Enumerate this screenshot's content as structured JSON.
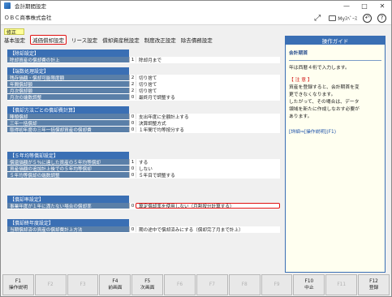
{
  "window": {
    "title": "会計期間設定"
  },
  "toolbar": {
    "company": "ＯＢＣ商事株式会社",
    "my_label": "Myｽﾍﾟｰｽ"
  },
  "mode_badge": "修正",
  "tabs": [
    {
      "label": "基本設定"
    },
    {
      "label": "減価償却設定"
    },
    {
      "label": "リース設定"
    },
    {
      "label": "償却資産税設定"
    },
    {
      "label": "制度改正設定"
    },
    {
      "label": "除去債務設定"
    }
  ],
  "sections": [
    {
      "title": "【除却設定】",
      "rows": [
        {
          "label": "除却資産の償却費の計上",
          "num": "1",
          "value": "除却月まで"
        }
      ]
    },
    {
      "title": "【端数処理設定】",
      "rows": [
        {
          "label": "残存価額・償却可能限度額",
          "num": "2",
          "value": "切り捨て"
        },
        {
          "label": "年間償却額",
          "num": "2",
          "value": "切り捨て"
        },
        {
          "label": "月次償却額",
          "num": "2",
          "value": "切り捨て"
        },
        {
          "label": "月次の端数調整",
          "num": "0",
          "value": "最終月で調整する"
        }
      ]
    },
    {
      "title": "【償却方法ごとの償却費計算】",
      "rows": [
        {
          "label": "陣頭償却",
          "num": "0",
          "value": "支出年度に全額計上する"
        },
        {
          "label": "三年一括償却",
          "num": "0",
          "value": "決算調整方式"
        },
        {
          "label": "取得初年度の三年一括償却資産の償却費",
          "num": "0",
          "value": "１年間で均等按分する"
        }
      ]
    },
    {
      "title": "【５年均等償却設定】",
      "rows": [
        {
          "label": "償還価額が５％に達した資産の５年均等償却",
          "num": "1",
          "value": "する"
        },
        {
          "label": "資産価額の追加計上後での５年均等償却",
          "num": "0",
          "value": "しない"
        },
        {
          "label": "５年均等償却の端数調整",
          "num": "0",
          "value": "５年目で調整する"
        }
      ]
    },
    {
      "title": "【償却率設定】",
      "rows": [
        {
          "label": "事業年度が１年に満たない場合の償却率",
          "num": "0",
          "value": "算定償却率を使用しない（月割按分計算する）",
          "highlight": true
        }
      ]
    },
    {
      "title": "【償却終年度設定】",
      "rows": [
        {
          "label": "当期償却済の資産の償却費計上方法",
          "num": "0",
          "value": "期の途中で償却済みにする（償却完了月まで計上）"
        }
      ]
    }
  ],
  "guide": {
    "header": "操作ガイド",
    "title": "会計期首",
    "text1": "年は西暦４桁で入力します。",
    "note_title": "【 注 意 】",
    "note_lines": [
      "資産を登録すると、会計期首を変",
      "更できなくなります。",
      "したがって、その場合は、データ",
      "領域を新たに作成しなおす必要が",
      "あります。"
    ],
    "link": "[詳細⇒[操作説明](F1)"
  },
  "fkeys": [
    {
      "key": "F1",
      "label": "操作説明",
      "enabled": true
    },
    {
      "key": "F2",
      "label": "",
      "enabled": false
    },
    {
      "key": "F3",
      "label": "",
      "enabled": false
    },
    {
      "key": "F4",
      "label": "前画面",
      "enabled": true
    },
    {
      "key": "F5",
      "label": "次画面",
      "enabled": true
    },
    {
      "key": "F6",
      "label": "",
      "enabled": false
    },
    {
      "key": "F7",
      "label": "",
      "enabled": false
    },
    {
      "key": "F8",
      "label": "",
      "enabled": false
    },
    {
      "key": "F9",
      "label": "",
      "enabled": false
    },
    {
      "key": "F10",
      "label": "中止",
      "enabled": true
    },
    {
      "key": "F11",
      "label": "",
      "enabled": false
    },
    {
      "key": "F12",
      "label": "登録",
      "enabled": true
    }
  ]
}
